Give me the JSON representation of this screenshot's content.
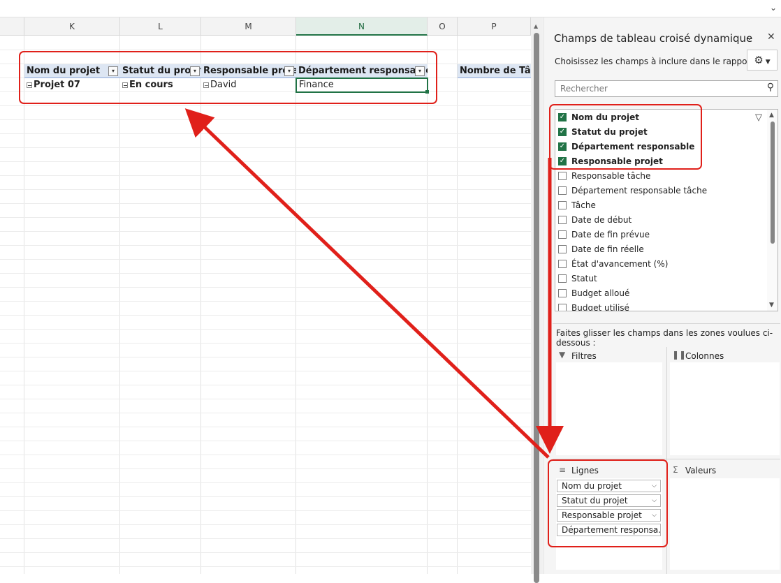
{
  "columns": [
    {
      "letter": "K"
    },
    {
      "letter": "L"
    },
    {
      "letter": "M"
    },
    {
      "letter": "N"
    },
    {
      "letter": "O"
    },
    {
      "letter": "P"
    }
  ],
  "pivot": {
    "headers": [
      "Nom du projet",
      "Statut du projet",
      "Responsable proje",
      "Département responsable"
    ],
    "extra_header": "Nombre de Tâch",
    "row": [
      "Projet 07",
      "En cours",
      "David",
      "Finance"
    ]
  },
  "pane": {
    "title": "Champs de tableau croisé dynamique",
    "subtitle": "Choisissez les champs à inclure dans le rapport :",
    "search_placeholder": "Rechercher",
    "fields": [
      {
        "label": "Nom du projet",
        "checked": true
      },
      {
        "label": "Statut du projet",
        "checked": true
      },
      {
        "label": "Département responsable",
        "checked": true
      },
      {
        "label": "Responsable projet",
        "checked": true
      },
      {
        "label": "Responsable tâche",
        "checked": false
      },
      {
        "label": "Département responsable tâche",
        "checked": false
      },
      {
        "label": "Tâche",
        "checked": false
      },
      {
        "label": "Date de début",
        "checked": false
      },
      {
        "label": "Date de fin prévue",
        "checked": false
      },
      {
        "label": "Date de fin réelle",
        "checked": false
      },
      {
        "label": "État d'avancement (%)",
        "checked": false
      },
      {
        "label": "Statut",
        "checked": false
      },
      {
        "label": "Budget alloué",
        "checked": false
      },
      {
        "label": "Budget utilisé",
        "checked": false
      }
    ],
    "drag_instruction": "Faites glisser les champs dans les zones voulues ci-dessous :",
    "areas": {
      "filters": "Filtres",
      "columns": "Colonnes",
      "rows": "Lignes",
      "values": "Valeurs"
    },
    "row_fields": [
      "Nom du projet",
      "Statut du projet",
      "Responsable projet",
      "Département responsa..."
    ]
  },
  "colors": {
    "highlight": "#e0201a",
    "excel_green": "#217346",
    "pivot_header_bg": "#dde6f3"
  }
}
